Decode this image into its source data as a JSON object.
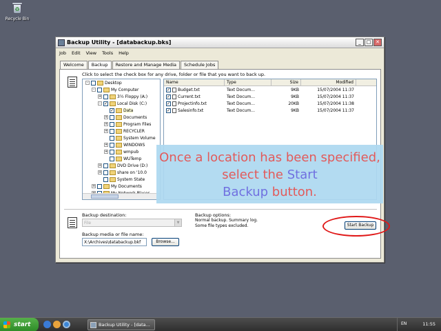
{
  "desktop": {
    "recycle_bin_label": "Recycle Bin"
  },
  "window": {
    "title": "Backup Utility - [databackup.bks]",
    "controls": {
      "minimize": "_",
      "maximize": "□",
      "close": "✕"
    },
    "menu": [
      "Job",
      "Edit",
      "View",
      "Tools",
      "Help"
    ],
    "tabs": [
      "Welcome",
      "Backup",
      "Restore and Manage Media",
      "Schedule Jobs"
    ],
    "active_tab": "Backup",
    "instruction": "Click to select the check box for any drive, folder or file that you want to back up.",
    "tree": [
      {
        "label": "Desktop",
        "indent": 0,
        "exp": "-",
        "checked": false
      },
      {
        "label": "My Computer",
        "indent": 1,
        "exp": "-",
        "checked": false
      },
      {
        "label": "3½ Floppy (A:)",
        "indent": 2,
        "exp": "+",
        "checked": false
      },
      {
        "label": "Local Disk (C:)",
        "indent": 2,
        "exp": "-",
        "checked": true
      },
      {
        "label": "Data",
        "indent": 3,
        "exp": "",
        "checked": true,
        "selected": true
      },
      {
        "label": "Documents",
        "indent": 3,
        "exp": "+",
        "checked": false
      },
      {
        "label": "Program Files",
        "indent": 3,
        "exp": "+",
        "checked": false
      },
      {
        "label": "RECYCLER",
        "indent": 3,
        "exp": "+",
        "checked": false
      },
      {
        "label": "System Volume",
        "indent": 3,
        "exp": "",
        "checked": false
      },
      {
        "label": "WINDOWS",
        "indent": 3,
        "exp": "+",
        "checked": false
      },
      {
        "label": "wmpub",
        "indent": 3,
        "exp": "+",
        "checked": false
      },
      {
        "label": "WUTemp",
        "indent": 3,
        "exp": "",
        "checked": false
      },
      {
        "label": "DVD Drive (D:)",
        "indent": 2,
        "exp": "+",
        "checked": false
      },
      {
        "label": "share on '10.0",
        "indent": 2,
        "exp": "+",
        "checked": false
      },
      {
        "label": "System State",
        "indent": 2,
        "exp": "",
        "checked": false
      },
      {
        "label": "My Documents",
        "indent": 1,
        "exp": "+",
        "checked": false
      },
      {
        "label": "My Network Places",
        "indent": 1,
        "exp": "+",
        "checked": false
      }
    ],
    "files_columns": {
      "name": "Name",
      "type": "Type",
      "size": "Size",
      "modified": "Modified"
    },
    "files": [
      {
        "name": "Budget.txt",
        "type": "Text Docum...",
        "size": "9KB",
        "modified": "15/07/2004 11:37"
      },
      {
        "name": "Current.txt",
        "type": "Text Docum...",
        "size": "9KB",
        "modified": "15/07/2004 11:37"
      },
      {
        "name": "Projectinfo.txt",
        "type": "Text Docum...",
        "size": "20KB",
        "modified": "15/07/2004 11:38"
      },
      {
        "name": "Salesinfo.txt",
        "type": "Text Docum...",
        "size": "9KB",
        "modified": "15/07/2004 11:37"
      }
    ],
    "destination_label": "Backup destination:",
    "destination_value": "File",
    "media_label": "Backup media or file name:",
    "media_value": "X:\\Archives\\databackup.bkf",
    "browse_label": "Browse...",
    "options_title": "Backup options:",
    "options_line1": "Normal backup.  Summary log.",
    "options_line2": "Some file types excluded.",
    "start_backup_label": "Start Backup"
  },
  "callout": {
    "part1": "Once a location has been specified, select the ",
    "highlight1": "Start",
    "highlight2": "Backup",
    "part2": " button."
  },
  "taskbar": {
    "start_label": "start",
    "task_label": "Backup Utility - [data...",
    "language": "EN",
    "clock": "11:55"
  },
  "colors": {
    "callout_text": "#e25a5a",
    "callout_highlight": "#7070e0",
    "annotation_ellipse": "#e01818"
  }
}
